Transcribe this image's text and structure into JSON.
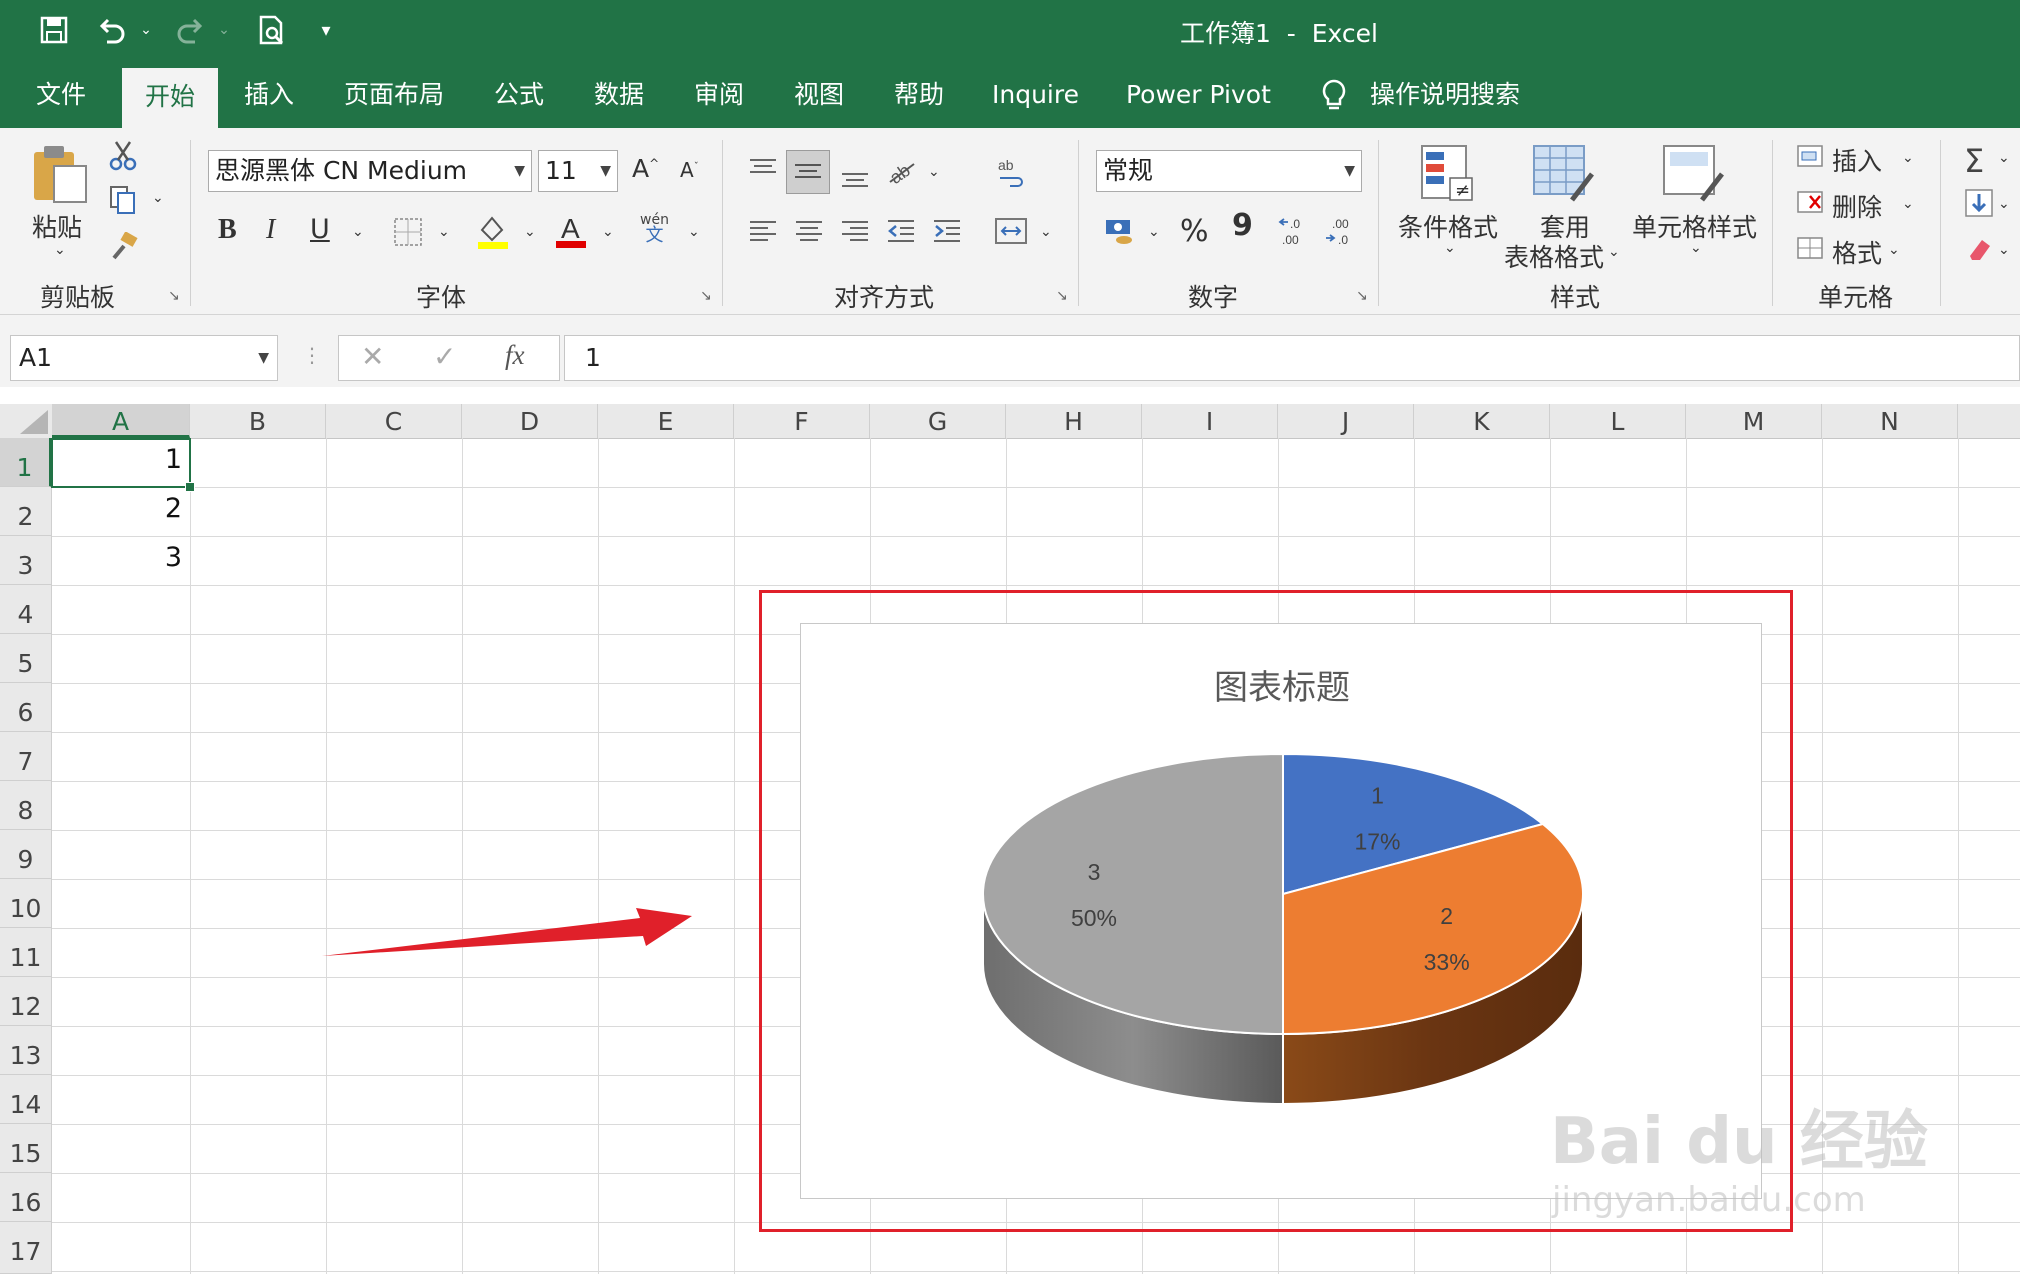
{
  "app": {
    "title": "工作簿1  -  Excel"
  },
  "tabs": [
    "文件",
    "开始",
    "插入",
    "页面布局",
    "公式",
    "数据",
    "审阅",
    "视图",
    "帮助",
    "Inquire",
    "Power Pivot",
    "操作说明搜索"
  ],
  "ribbon": {
    "clipboard": {
      "paste": "粘贴",
      "group": "剪贴板"
    },
    "font": {
      "name": "思源黑体 CN Medium",
      "size": "11",
      "group": "字体",
      "bold": "B",
      "italic": "I",
      "underline": "U",
      "phonetic_top": "wén",
      "phonetic_bottom": "文"
    },
    "align": {
      "group": "对齐方式"
    },
    "number": {
      "format": "常规",
      "group": "数字",
      "percent": "%",
      "comma": "9"
    },
    "styles": {
      "cond": "条件格式",
      "table1": "套用",
      "table2": "表格格式",
      "cell": "单元格样式",
      "group": "样式"
    },
    "cells": {
      "insert": "插入",
      "delete": "删除",
      "format": "格式",
      "group": "单元格"
    }
  },
  "formula_bar": {
    "name_box": "A1",
    "fx": "fx",
    "value": "1"
  },
  "columns": [
    "A",
    "B",
    "C",
    "D",
    "E",
    "F",
    "G",
    "H",
    "I",
    "J",
    "K",
    "L",
    "M",
    "N"
  ],
  "rows": [
    "1",
    "2",
    "3",
    "4",
    "5",
    "6",
    "7",
    "8",
    "9",
    "10",
    "11",
    "12",
    "13",
    "14",
    "15",
    "16",
    "17"
  ],
  "cells": {
    "A1": "1",
    "A2": "2",
    "A3": "3"
  },
  "chart_data": {
    "type": "pie",
    "title": "图表标题",
    "categories": [
      "1",
      "2",
      "3"
    ],
    "values": [
      1,
      2,
      3
    ],
    "percent_labels": [
      "17%",
      "33%",
      "50%"
    ],
    "colors": [
      "#4472c4",
      "#ed7d31",
      "#a5a5a5"
    ],
    "style": "3d"
  },
  "watermark": {
    "line1": "Bai du 经验",
    "line2": "jingyan.baidu.com"
  },
  "colors": {
    "excel_green": "#217346",
    "highlight_red": "#e0202a"
  }
}
